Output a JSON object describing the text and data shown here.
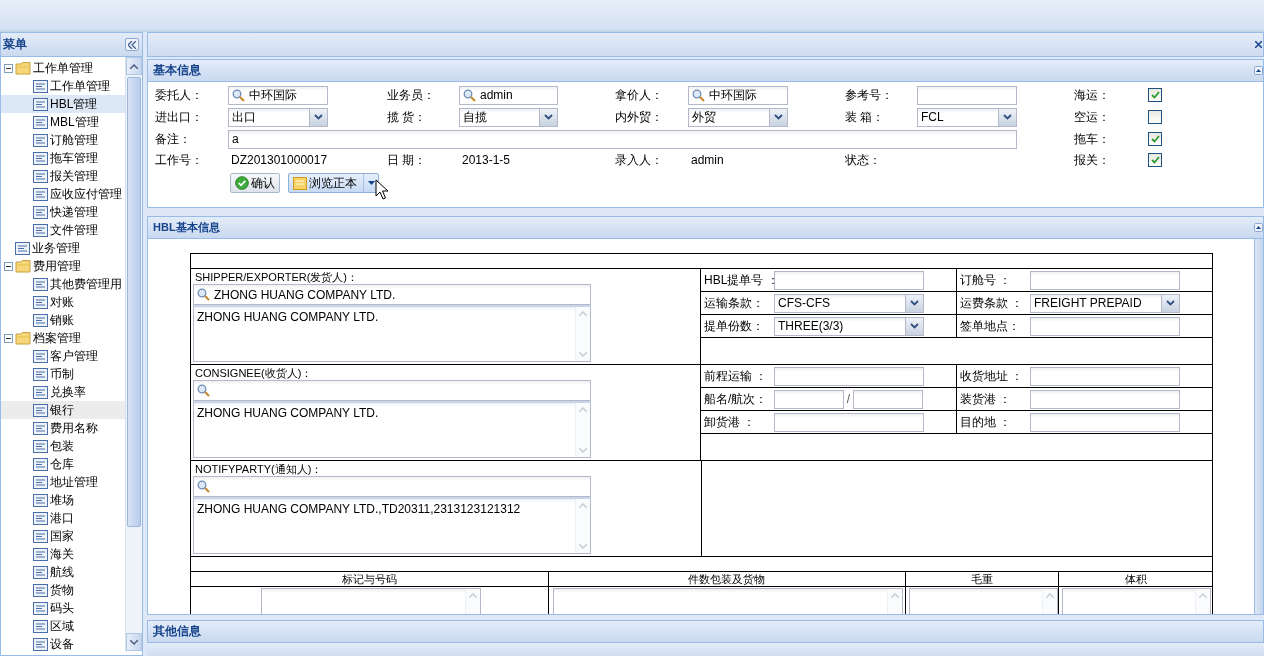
{
  "menu": {
    "title": "菜单",
    "items": [
      {
        "label": "工作单管理",
        "expanded": true,
        "selected": false,
        "hovered": false,
        "children": [
          {
            "label": "工作单管理",
            "selected": false,
            "hovered": false
          },
          {
            "label": "HBL管理",
            "selected": true,
            "hovered": false
          },
          {
            "label": "MBL管理",
            "selected": false,
            "hovered": false
          },
          {
            "label": "订舱管理",
            "selected": false,
            "hovered": false
          },
          {
            "label": "拖车管理",
            "selected": false,
            "hovered": false
          },
          {
            "label": "报关管理",
            "selected": false,
            "hovered": false
          },
          {
            "label": "应收应付管理",
            "selected": false,
            "hovered": false
          },
          {
            "label": "快递管理",
            "selected": false,
            "hovered": false
          },
          {
            "label": "文件管理",
            "selected": false,
            "hovered": false
          }
        ]
      },
      {
        "label": "业务管理",
        "selected": false,
        "hovered": false
      },
      {
        "label": "费用管理",
        "expanded": true,
        "selected": false,
        "hovered": false,
        "children": [
          {
            "label": "其他费管理用",
            "selected": false,
            "hovered": false
          },
          {
            "label": "对账",
            "selected": false,
            "hovered": false
          },
          {
            "label": "销账",
            "selected": false,
            "hovered": false
          }
        ]
      },
      {
        "label": "档案管理",
        "expanded": true,
        "selected": false,
        "hovered": false,
        "children": [
          {
            "label": "客户管理",
            "selected": false,
            "hovered": false
          },
          {
            "label": "币制",
            "selected": false,
            "hovered": false
          },
          {
            "label": "兑换率",
            "selected": false,
            "hovered": false
          },
          {
            "label": "银行",
            "selected": false,
            "hovered": true
          },
          {
            "label": "费用名称",
            "selected": false,
            "hovered": false
          },
          {
            "label": "包装",
            "selected": false,
            "hovered": false
          },
          {
            "label": "仓库",
            "selected": false,
            "hovered": false
          },
          {
            "label": "地址管理",
            "selected": false,
            "hovered": false
          },
          {
            "label": "堆场",
            "selected": false,
            "hovered": false
          },
          {
            "label": "港口",
            "selected": false,
            "hovered": false
          },
          {
            "label": "国家",
            "selected": false,
            "hovered": false
          },
          {
            "label": "海关",
            "selected": false,
            "hovered": false
          },
          {
            "label": "航线",
            "selected": false,
            "hovered": false
          },
          {
            "label": "货物",
            "selected": false,
            "hovered": false
          },
          {
            "label": "码头",
            "selected": false,
            "hovered": false
          },
          {
            "label": "区域",
            "selected": false,
            "hovered": false
          },
          {
            "label": "设备",
            "selected": false,
            "hovered": false
          }
        ]
      }
    ]
  },
  "basic": {
    "title": "基本信息",
    "rows": [
      {
        "cells": [
          {
            "label": "委托人：",
            "kind": "lookup",
            "value": "中环国际"
          },
          {
            "label": "业务员：",
            "kind": "lookup",
            "value": "admin"
          },
          {
            "label": "拿价人：",
            "kind": "lookup",
            "value": "中环国际"
          },
          {
            "label": "参考号：",
            "kind": "text"
          }
        ],
        "check": {
          "label": "海运：",
          "checked": true
        }
      },
      {
        "cells": [
          {
            "label": "进出口：",
            "kind": "select",
            "value": "出口"
          },
          {
            "label": "揽 货：",
            "kind": "select",
            "value": "自揽"
          },
          {
            "label": "内外贸：",
            "kind": "select",
            "value": "外贸"
          },
          {
            "label": "装 箱：",
            "kind": "select",
            "value": "FCL"
          }
        ],
        "check": {
          "label": "空运：",
          "checked": false
        }
      },
      {
        "cells": [
          {
            "label": "备注：",
            "kind": "wide",
            "value": "a"
          }
        ],
        "check": {
          "label": "拖车：",
          "checked": true
        }
      },
      {
        "cells": [
          {
            "label": "工作号：",
            "kind": "plain",
            "value": "DZ201301000017"
          },
          {
            "label": "日 期：",
            "kind": "plain",
            "value": "2013-1-5"
          },
          {
            "label": "录入人：",
            "kind": "plain",
            "value": "admin"
          },
          {
            "label": "状态：",
            "kind": "plain"
          }
        ],
        "check": {
          "label": "报关：",
          "checked": true
        }
      }
    ],
    "buttons": [
      {
        "label": "确认",
        "kind": "confirm"
      },
      {
        "label": "浏览正本",
        "kind": "split"
      }
    ]
  },
  "hbl": {
    "title": "HBL基本信息",
    "parties": [
      {
        "label": "SHIPPER/EXPORTER(发货人)：",
        "lookup": "ZHONG HUANG COMPANY LTD.",
        "text": "ZHONG HUANG COMPANY LTD.",
        "rows": [
          [
            {
              "label": "HBL提单号 ：",
              "kind": "text"
            },
            {
              "label": "订舱号 ：",
              "kind": "text"
            }
          ],
          [
            {
              "label": "运输条款：",
              "kind": "select",
              "value": "CFS-CFS"
            },
            {
              "label": "运费条款 ：",
              "kind": "select",
              "value": "FREIGHT PREPAID"
            }
          ],
          [
            {
              "label": "提单份数：",
              "kind": "select",
              "value": "THREE(3/3)"
            },
            {
              "label": "签单地点：",
              "kind": "text"
            }
          ]
        ]
      },
      {
        "label": "CONSIGNEE(收货人)：",
        "text": "ZHONG HUANG COMPANY LTD.",
        "rows": [
          [
            {
              "label": "前程运输 ：",
              "kind": "text"
            },
            {
              "label": "收货地址 ：",
              "kind": "text"
            }
          ],
          [
            {
              "label": "船名/航次：",
              "kind": "split",
              "value": "/"
            },
            {
              "label": "装货港 ：",
              "kind": "text"
            }
          ],
          [
            {
              "label": "卸货港 ：",
              "kind": "text"
            },
            {
              "label": "目的地 ：",
              "kind": "text"
            }
          ]
        ]
      },
      {
        "label": "NOTIFYPARTY(通知人)：",
        "text": "ZHONG HUANG COMPANY LTD.,TD20311,2313123121312"
      }
    ],
    "cargo_columns": [
      "标记与号码",
      "件数包装及货物",
      "毛重",
      "体积"
    ]
  },
  "other": {
    "title": "其他信息"
  }
}
